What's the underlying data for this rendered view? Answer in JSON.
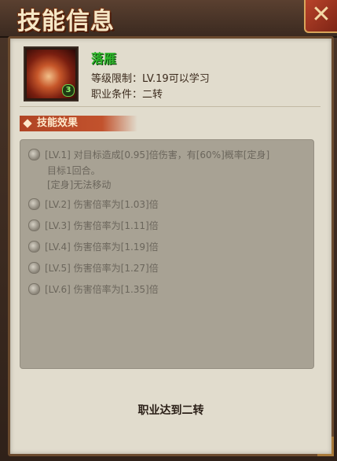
{
  "window": {
    "title": "技能信息",
    "close_glyph": "✕"
  },
  "skill": {
    "icon": "flame-swirl-skill-icon",
    "level_badge": "3",
    "name": "落雁",
    "level_req": "等级限制：LV.19可以学习",
    "class_req": "职业条件：二转"
  },
  "section": {
    "label": "技能效果"
  },
  "effects": [
    {
      "line1": "[LV.1] 对目标造成[0.95]倍伤害，有[60%]概率[定身]",
      "line2": "目标1回合。",
      "line3": "[定身]无法移动"
    },
    {
      "line1": "[LV.2] 伤害倍率为[1.03]倍"
    },
    {
      "line1": "[LV.3] 伤害倍率为[1.11]倍"
    },
    {
      "line1": "[LV.4] 伤害倍率为[1.19]倍"
    },
    {
      "line1": "[LV.5] 伤害倍率为[1.27]倍"
    },
    {
      "line1": "[LV.6] 伤害倍率为[1.35]倍"
    }
  ],
  "footer": {
    "condition_text": "职业达到二转"
  },
  "colors": {
    "skill_name": "#2db52a",
    "section_ribbon": "#b04424",
    "effects_box": "#a8a294",
    "panel": "#e1dccd"
  }
}
